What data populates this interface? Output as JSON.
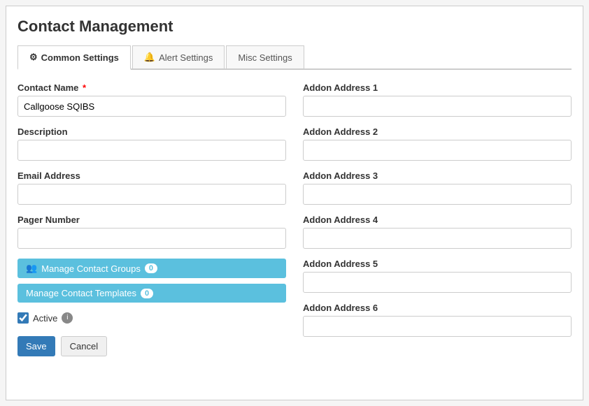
{
  "page": {
    "title": "Contact Management"
  },
  "tabs": [
    {
      "id": "common",
      "label": "Common Settings",
      "icon": "gear",
      "active": true
    },
    {
      "id": "alert",
      "label": "Alert Settings",
      "icon": "bell",
      "active": false
    },
    {
      "id": "misc",
      "label": "Misc Settings",
      "icon": "",
      "active": false
    }
  ],
  "form": {
    "left": {
      "contact_name": {
        "label": "Contact Name",
        "required": true,
        "value": "Callgoose SQIBS",
        "placeholder": ""
      },
      "description": {
        "label": "Description",
        "value": "",
        "placeholder": ""
      },
      "email_address": {
        "label": "Email Address",
        "value": "",
        "placeholder": ""
      },
      "pager_number": {
        "label": "Pager Number",
        "value": "",
        "placeholder": ""
      }
    },
    "right": {
      "addon1": {
        "label": "Addon Address 1",
        "value": "",
        "placeholder": ""
      },
      "addon2": {
        "label": "Addon Address 2",
        "value": "",
        "placeholder": ""
      },
      "addon3": {
        "label": "Addon Address 3",
        "value": "",
        "placeholder": ""
      },
      "addon4": {
        "label": "Addon Address 4",
        "value": "",
        "placeholder": ""
      },
      "addon5": {
        "label": "Addon Address 5",
        "value": "",
        "placeholder": ""
      },
      "addon6": {
        "label": "Addon Address 6",
        "value": "",
        "placeholder": ""
      }
    }
  },
  "buttons": {
    "manage_contact_groups": {
      "label": "Manage Contact Groups",
      "badge": "0"
    },
    "manage_contact_templates": {
      "label": "Manage Contact Templates",
      "badge": "0"
    }
  },
  "active_checkbox": {
    "label": "Active",
    "checked": true
  },
  "save_button": "Save",
  "cancel_button": "Cancel"
}
